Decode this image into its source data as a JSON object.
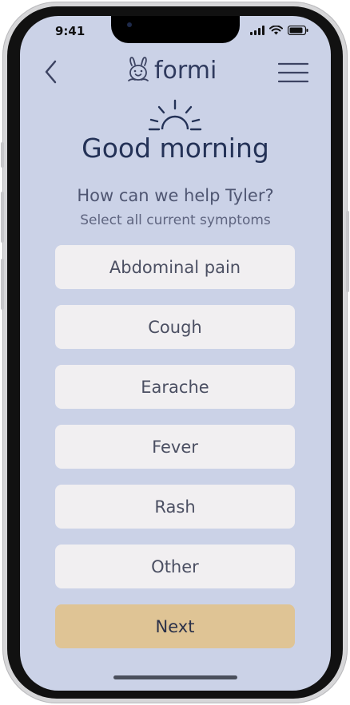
{
  "status_bar": {
    "time": "9:41",
    "icons": [
      "signal-icon",
      "wifi-icon",
      "battery-icon"
    ]
  },
  "nav": {
    "back_icon": "chevron-left-icon",
    "logo_text": "formi",
    "logo_icon": "bunny-icon",
    "menu_icon": "hamburger-menu-icon"
  },
  "header": {
    "sun_icon": "sunrise-icon",
    "greeting": "Good morning",
    "question": "How can we help Tyler?",
    "subtext": "Select all current symptoms"
  },
  "symptoms": [
    {
      "label": "Abdominal pain"
    },
    {
      "label": "Cough"
    },
    {
      "label": "Earache"
    },
    {
      "label": "Fever"
    },
    {
      "label": "Rash"
    },
    {
      "label": "Other"
    }
  ],
  "next_label": "Next",
  "colors": {
    "screen_bg": "#cbd2e7",
    "option_bg": "#f1eff1",
    "next_bg": "#dfc495",
    "heading": "#243257"
  }
}
